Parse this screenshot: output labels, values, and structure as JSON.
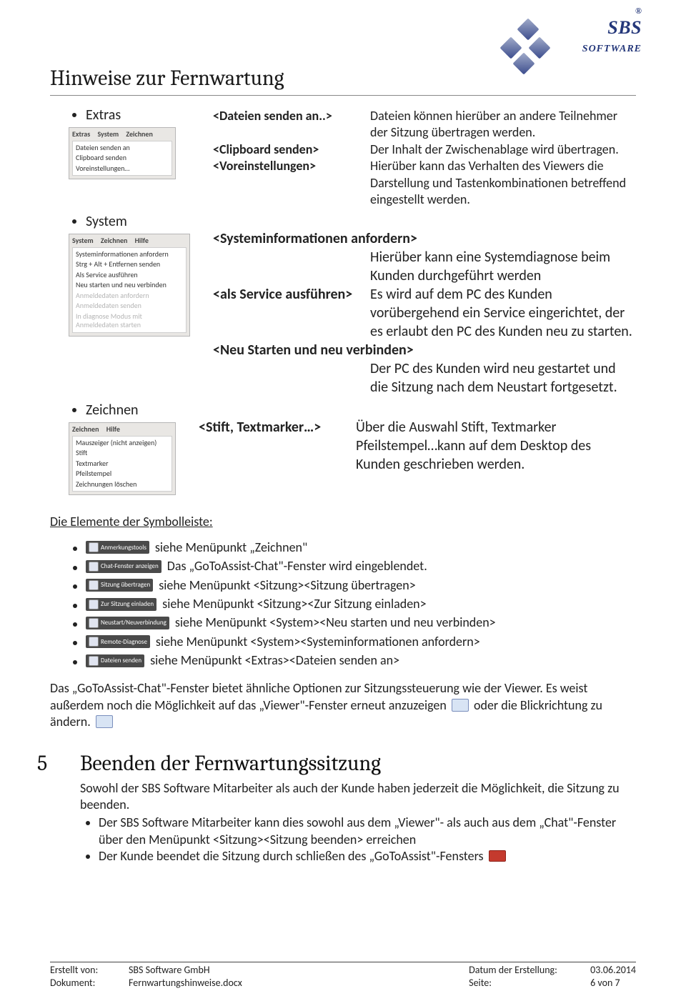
{
  "brand": {
    "name": "SBS",
    "sub": "SOFTWARE",
    "reg": "®"
  },
  "title": "Hinweise zur Fernwartung",
  "extras": {
    "label": "Extras",
    "menu": {
      "tabs": [
        "Extras",
        "System",
        "Zeichnen"
      ],
      "items": [
        "Dateien senden an",
        "Clipboard senden",
        "Voreinstellungen…"
      ]
    },
    "rows": [
      {
        "tag": "<Dateien senden an..>",
        "desc": "Dateien können hierüber an andere Teilnehmer der Sitzung übertragen werden."
      },
      {
        "tag": "<Clipboard senden>",
        "desc": "Der Inhalt der Zwischenablage wird übertragen."
      },
      {
        "tag": "<Voreinstellungen>",
        "desc": "Hierüber kann das Verhalten des Viewers die Darstellung und Tastenkombinationen betreffend eingestellt werden."
      }
    ]
  },
  "system": {
    "label": "System",
    "menu": {
      "tabs": [
        "System",
        "Zeichnen",
        "Hilfe"
      ],
      "items": [
        "Systeminformationen anfordern",
        "Strg + Alt + Entfernen senden",
        "Als Service ausführen",
        "Neu starten und neu verbinden"
      ],
      "disabled": [
        "Anmeldedaten anfordern",
        "Anmeldedaten senden",
        "In diagnose Modus mit Anmeldedaten starten"
      ]
    },
    "head1": "<Systeminformationen anfordern>",
    "head1_desc": "Hierüber kann eine Systemdiagnose beim Kunden durchgeführt werden",
    "row_service_tag": "<als Service ausführen>",
    "row_service_desc": "Es wird auf dem PC des Kunden vorübergehend ein Service eingerichtet, der es erlaubt den PC des Kunden neu zu starten.",
    "head2": "<Neu Starten und neu verbinden>",
    "head2_desc": "Der PC des Kunden wird neu gestartet und die Sitzung nach dem Neustart fortgesetzt."
  },
  "zeichnen": {
    "label": "Zeichnen",
    "menu": {
      "tabs": [
        "Zeichnen",
        "Hilfe"
      ],
      "items": [
        "Mauszeiger (nicht anzeigen)",
        "Stift",
        "Textmarker",
        "Pfeilstempel",
        "Zeichnungen löschen"
      ]
    },
    "row_tag": "<Stift, Textmarker…>",
    "row_desc": "Über die Auswahl Stift, Textmarker Pfeilstempel…kann auf dem Desktop des Kunden geschrieben werden."
  },
  "symbolleiste_heading": "Die Elemente der Symbolleiste:",
  "toolbar_rows": [
    {
      "btn": "Anmerkungstools",
      "desc": "siehe Menüpunkt „Zeichnen\""
    },
    {
      "btn": "Chat-Fenster anzeigen",
      "desc": "Das „GoToAssist-Chat\"-Fenster wird eingeblendet."
    },
    {
      "btn": "Sitzung übertragen",
      "desc": "siehe Menüpunkt <Sitzung><Sitzung übertragen>"
    },
    {
      "btn": "Zur Sitzung einladen",
      "desc": "siehe Menüpunkt <Sitzung><Zur Sitzung einladen>"
    },
    {
      "btn": "Neustart/Neuverbindung",
      "desc": "siehe Menüpunkt <System><Neu starten und neu verbinden>"
    },
    {
      "btn": "Remote-Diagnose",
      "desc": "siehe Menüpunkt <System><Systeminformationen anfordern>"
    },
    {
      "btn": "Dateien senden",
      "desc": "siehe Menüpunkt <Extras><Dateien senden an>"
    }
  ],
  "chat_para_a": "Das „GoToAssist-Chat\"-Fenster bietet ähnliche Optionen zur Sitzungssteuerung wie der Viewer. Es weist außerdem noch die Möglichkeit auf das „Viewer\"-Fenster erneut anzuzeigen",
  "chat_para_b": "oder die Blickrichtung zu ändern.",
  "sec5": {
    "num": "5",
    "title": "Beenden der Fernwartungssitzung",
    "lead": "Sowohl der SBS Software Mitarbeiter als auch der Kunde haben jederzeit die Möglichkeit, die Sitzung zu beenden.",
    "b1": "Der SBS Software Mitarbeiter kann dies sowohl aus dem „Viewer\"- als auch aus dem „Chat\"-Fenster über den Menüpunkt <Sitzung><Sitzung beenden> erreichen",
    "b2": "Der Kunde beendet die Sitzung durch schließen des „GoToAssist\"-Fensters"
  },
  "footer": {
    "l1k": "Erstellt von:",
    "l1v": "SBS Software GmbH",
    "l2k": "Dokument:",
    "l2v": "Fernwartungshinweise.docx",
    "r1k": "Datum der Erstellung:",
    "r1v": "03.06.2014",
    "r2k": "Seite:",
    "r2v": "6 von 7"
  }
}
